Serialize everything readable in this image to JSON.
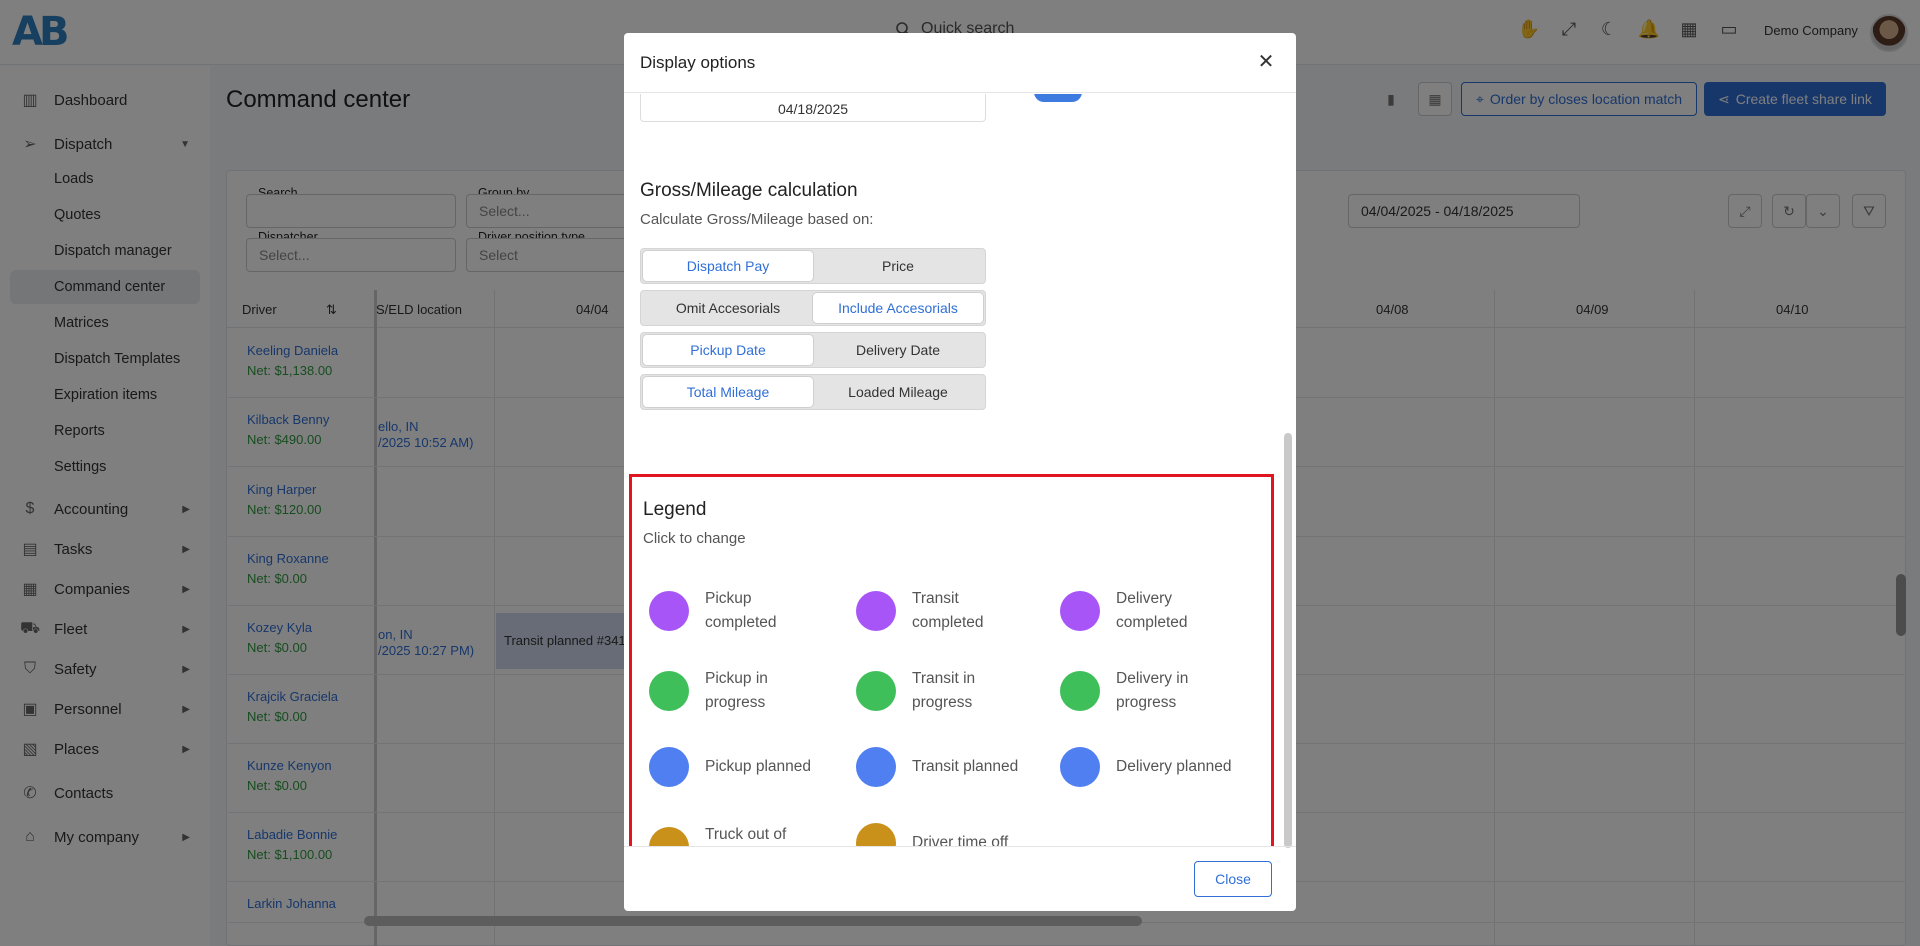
{
  "topbar": {
    "logo": "AB",
    "quick_search": "Quick search",
    "company": "Demo Company",
    "icons": [
      "hand-icon",
      "expand-icon",
      "moon-icon",
      "bell-icon",
      "grid-icon",
      "wallet-icon"
    ]
  },
  "sidebar": {
    "items": [
      {
        "label": "Dashboard",
        "icon": "chart-icon"
      },
      {
        "label": "Dispatch",
        "icon": "send-icon"
      },
      {
        "label": "Accounting",
        "icon": "dollar-icon"
      },
      {
        "label": "Tasks",
        "icon": "clipboard-icon"
      },
      {
        "label": "Companies",
        "icon": "building-icon"
      },
      {
        "label": "Fleet",
        "icon": "truck-icon"
      },
      {
        "label": "Safety",
        "icon": "shield-icon"
      },
      {
        "label": "Personnel",
        "icon": "id-card-icon"
      },
      {
        "label": "Places",
        "icon": "map-icon"
      },
      {
        "label": "Contacts",
        "icon": "phone-icon"
      },
      {
        "label": "My company",
        "icon": "home-icon"
      }
    ],
    "dispatch_sub": [
      "Loads",
      "Quotes",
      "Dispatch manager",
      "Command center",
      "Matrices",
      "Dispatch Templates",
      "Expiration items",
      "Reports",
      "Settings"
    ]
  },
  "page": {
    "title": "Command center",
    "order_btn": "Order by closes location match",
    "share_btn": "Create fleet share link",
    "filters": {
      "search_label": "Search",
      "group_by_label": "Group by",
      "group_by_placeholder": "Select...",
      "dispatcher_label": "Dispatcher",
      "dispatcher_placeholder": "Select...",
      "driver_pos_label": "Driver position type",
      "driver_pos_placeholder": "Select",
      "date_range": "04/04/2025 - 04/18/2025"
    },
    "grid": {
      "col_driver": "Driver",
      "col_loc": "S/ELD location",
      "dates": [
        "04/04",
        "04/08",
        "04/09",
        "04/10"
      ],
      "rows": [
        {
          "name": "Keeling Daniela",
          "net": "Net: $1,138.00",
          "loc1": "",
          "loc2": ""
        },
        {
          "name": "Kilback Benny",
          "net": "Net: $490.00",
          "loc1": "ello, IN",
          "loc2": "/2025 10:52 AM)"
        },
        {
          "name": "King Harper",
          "net": "Net: $120.00",
          "loc1": "",
          "loc2": ""
        },
        {
          "name": "King Roxanne",
          "net": "Net: $0.00",
          "loc1": "",
          "loc2": ""
        },
        {
          "name": "Kozey Kyla",
          "net": "Net: $0.00",
          "loc1": "on, IN",
          "loc2": "/2025 10:27 PM)"
        },
        {
          "name": "Krajcik Graciela",
          "net": "Net: $0.00",
          "loc1": "",
          "loc2": ""
        },
        {
          "name": "Kunze Kenyon",
          "net": "Net: $0.00",
          "loc1": "",
          "loc2": ""
        },
        {
          "name": "Labadie Bonnie",
          "net": "Net: $1,100.00",
          "loc1": "",
          "loc2": ""
        },
        {
          "name": "Larkin Johanna",
          "net": "",
          "loc1": "",
          "loc2": ""
        }
      ],
      "transit_chip": "Transit planned #341"
    }
  },
  "modal": {
    "title": "Display options",
    "date_value": "04/18/2025",
    "gross_title": "Gross/Mileage calculation",
    "gross_sub": "Calculate Gross/Mileage based on:",
    "segments": [
      {
        "a": "Dispatch Pay",
        "b": "Price",
        "selected": "a"
      },
      {
        "a": "Omit Accesorials",
        "b": "Include Accesorials",
        "selected": "b"
      },
      {
        "a": "Pickup Date",
        "b": "Delivery Date",
        "selected": "a"
      },
      {
        "a": "Total Mileage",
        "b": "Loaded Mileage",
        "selected": "a"
      }
    ],
    "legend": {
      "title": "Legend",
      "subtitle": "Click to change",
      "items": [
        {
          "label": "Pickup completed",
          "color": "#a855f7"
        },
        {
          "label": "Transit completed",
          "color": "#a855f7"
        },
        {
          "label": "Delivery completed",
          "color": "#a855f7"
        },
        {
          "label": "Pickup in progress",
          "color": "#3fbf5a"
        },
        {
          "label": "Transit in progress",
          "color": "#3fbf5a"
        },
        {
          "label": "Delivery in progress",
          "color": "#3fbf5a"
        },
        {
          "label": "Pickup planned",
          "color": "#4f7ff0"
        },
        {
          "label": "Transit planned",
          "color": "#4f7ff0"
        },
        {
          "label": "Delivery planned",
          "color": "#4f7ff0"
        },
        {
          "label": "Truck out of service",
          "color": "#c9911a"
        },
        {
          "label": "Driver time off",
          "color": "#c9911a"
        }
      ]
    },
    "close_label": "Close"
  }
}
